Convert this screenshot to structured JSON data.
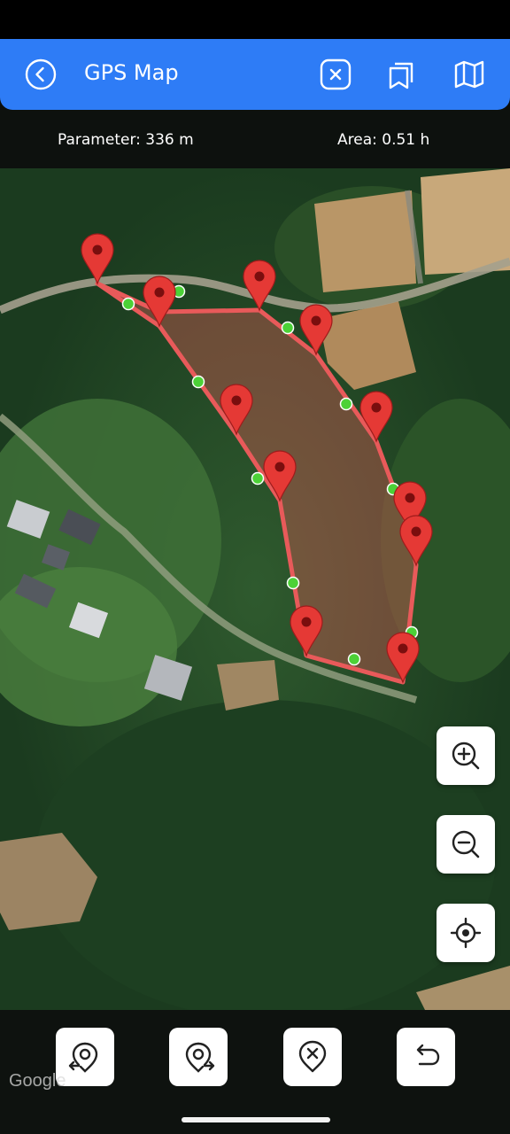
{
  "header": {
    "title": "GPS Map",
    "back_icon": "back-arrow-circle-icon",
    "actions": [
      "clear-icon",
      "layers-icon",
      "map-type-icon"
    ],
    "color": "#2e7cf6"
  },
  "stats": {
    "parameter": "Parameter: 336 m",
    "area": "Area: 0.51 h"
  },
  "map": {
    "type": "satellite",
    "polygon_stroke": "#e85a5a",
    "polygon_fill": "rgba(232,90,90,0.38)",
    "vertex_marker_color": "#e53935",
    "midpoint_color": "#4cd137",
    "vertex_count": 12,
    "attribution": "Google"
  },
  "zoom_controls": [
    "zoom-in-icon",
    "zoom-out-icon",
    "my-location-icon"
  ],
  "toolbar": [
    "start-point-icon",
    "end-point-icon",
    "delete-point-icon",
    "undo-icon"
  ]
}
